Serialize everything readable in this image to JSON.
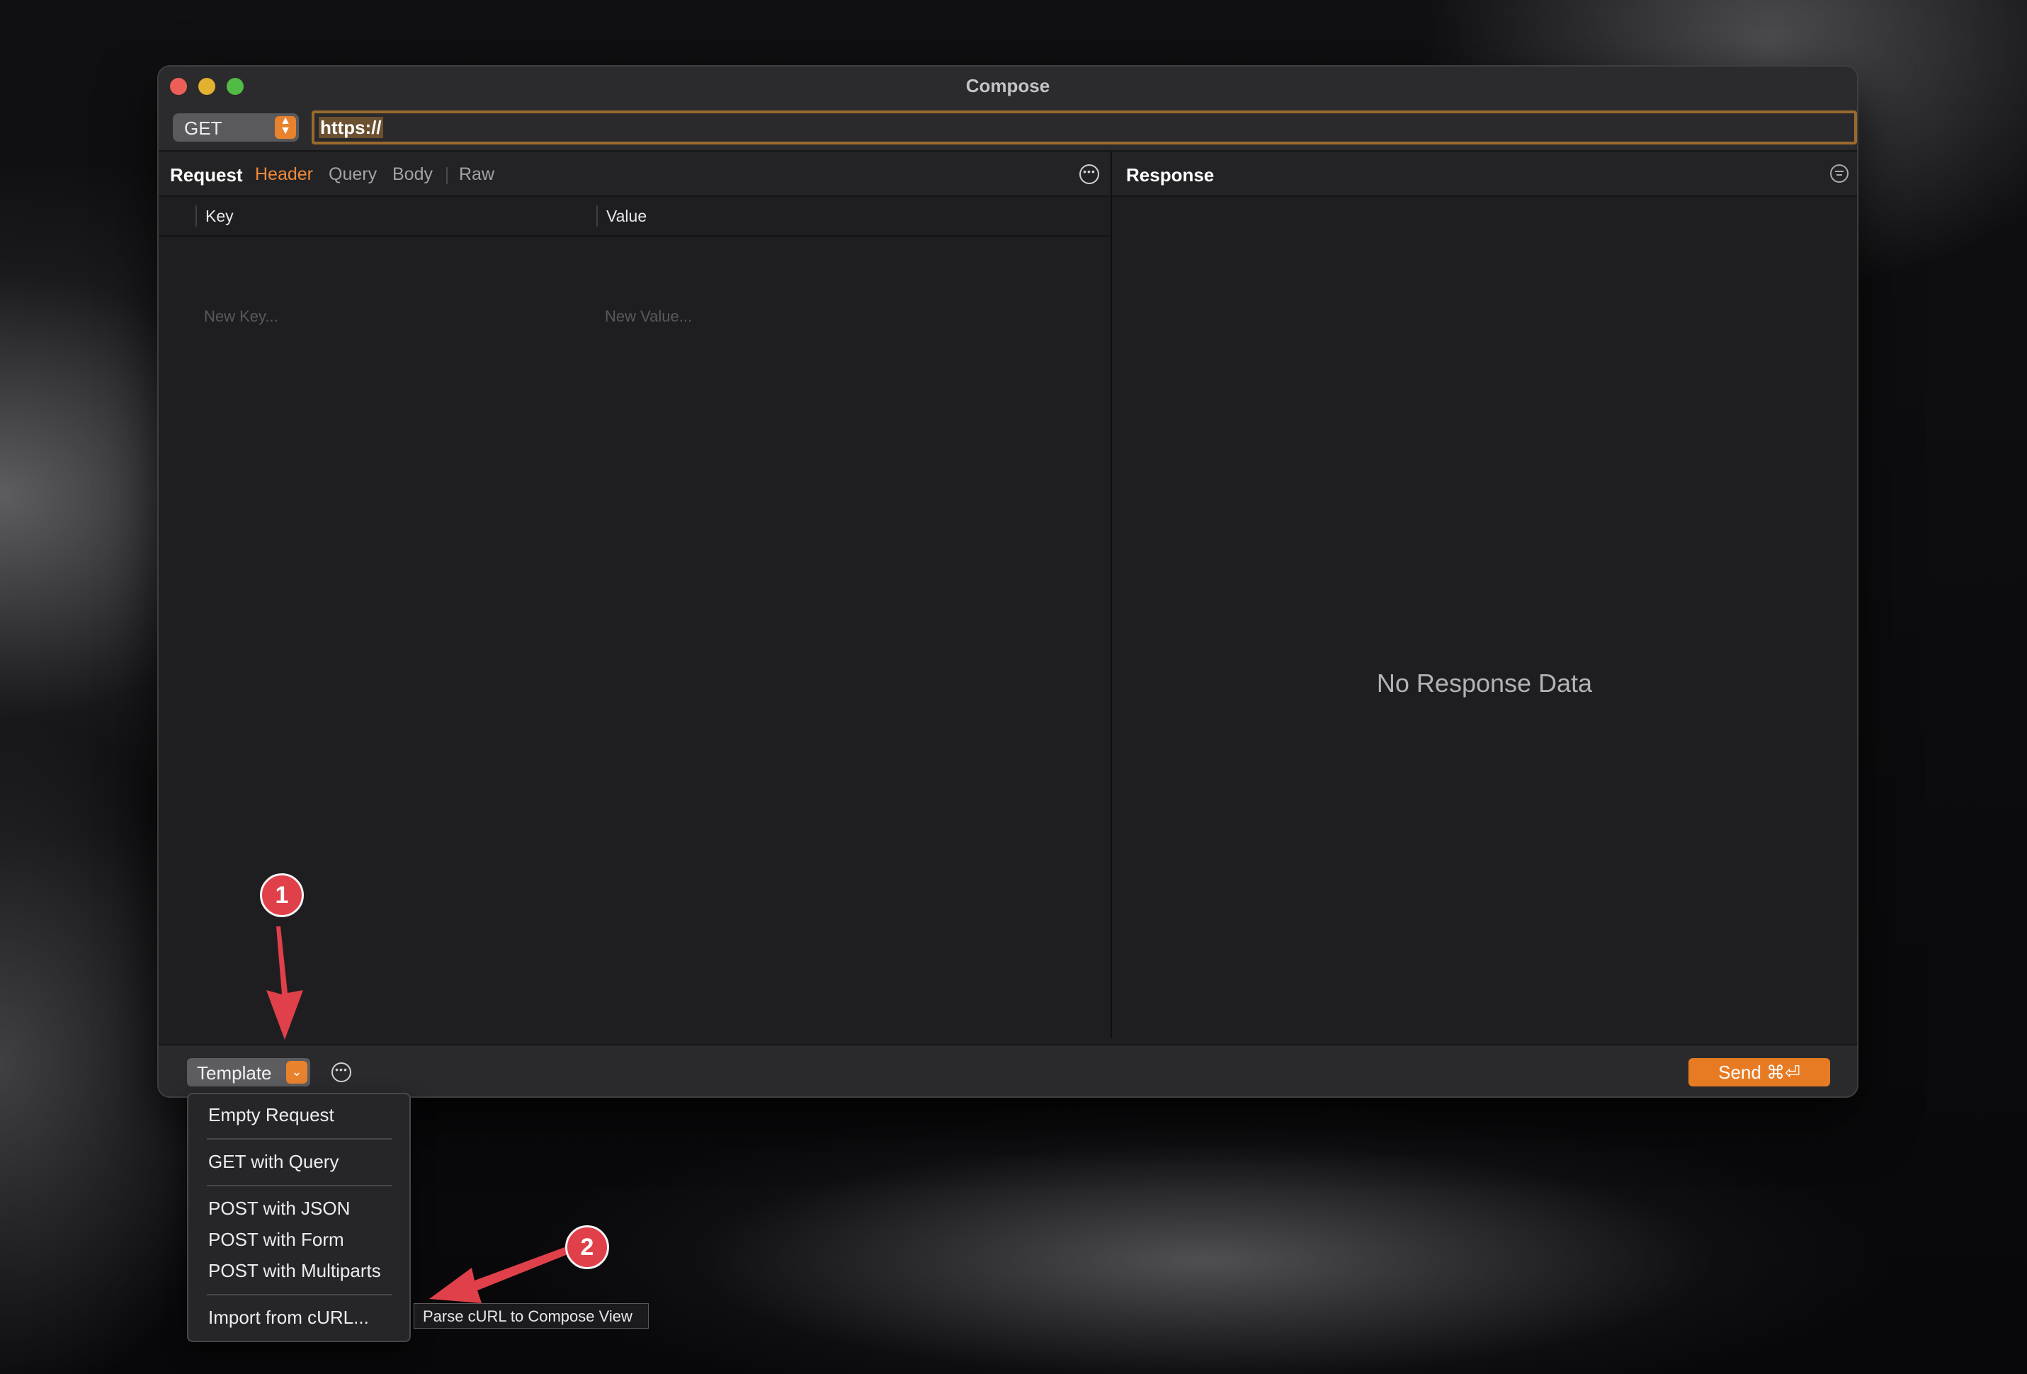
{
  "window": {
    "title": "Compose"
  },
  "urlbar": {
    "method": "GET",
    "url": "https://"
  },
  "request": {
    "title": "Request",
    "tabs": [
      "Header",
      "Query",
      "Body",
      "Raw"
    ],
    "active_tab": "Header",
    "table": {
      "columns": [
        "Key",
        "Value"
      ],
      "key_placeholder": "New Key...",
      "value_placeholder": "New Value..."
    }
  },
  "response": {
    "title": "Response",
    "empty_text": "No Response Data"
  },
  "bottombar": {
    "template_label": "Template",
    "send_label": "Send ⌘⏎"
  },
  "template_menu": {
    "items": [
      "Empty Request",
      "GET with Query",
      "POST with JSON",
      "POST with Form",
      "POST with Multiparts",
      "Import from cURL..."
    ]
  },
  "tooltip": "Parse cURL to Compose View",
  "annotations": [
    "1",
    "2"
  ],
  "colors": {
    "accent": "#e77b23",
    "annotation": "#e0404a",
    "window_bg": "#1f1f21"
  }
}
